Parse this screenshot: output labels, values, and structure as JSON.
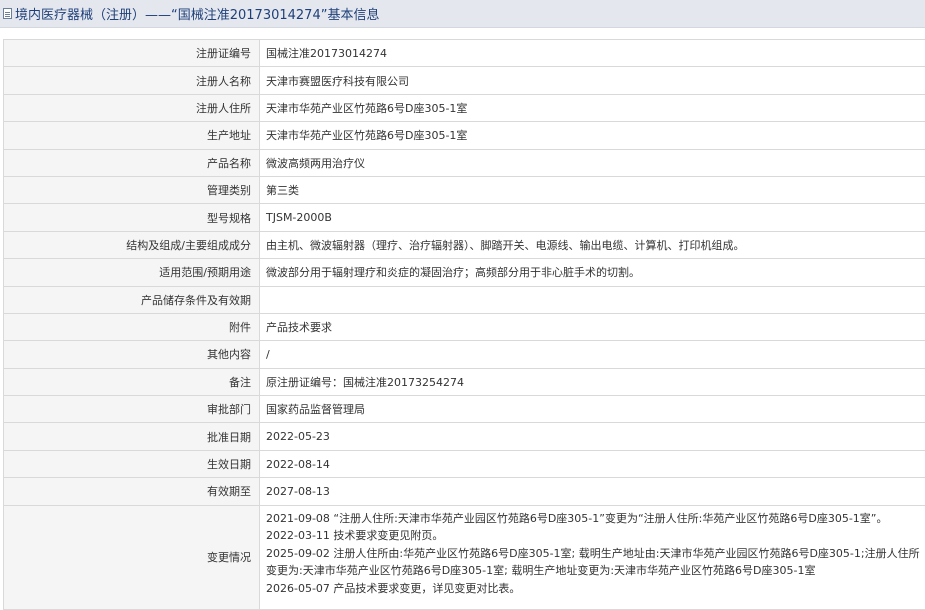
{
  "header": {
    "title": "境内医疗器械（注册）——“国械注准20173014274”基本信息"
  },
  "rows": [
    {
      "label": "注册证编号",
      "value": "国械注准20173014274"
    },
    {
      "label": "注册人名称",
      "value": "天津市赛盟医疗科技有限公司"
    },
    {
      "label": "注册人住所",
      "value": "天津市华苑产业区竹苑路6号D座305-1室"
    },
    {
      "label": "生产地址",
      "value": "天津市华苑产业区竹苑路6号D座305-1室"
    },
    {
      "label": "产品名称",
      "value": "微波高频两用治疗仪"
    },
    {
      "label": "管理类别",
      "value": "第三类"
    },
    {
      "label": "型号规格",
      "value": "TJSM-2000B"
    },
    {
      "label": "结构及组成/主要组成成分",
      "value": "由主机、微波辐射器（理疗、治疗辐射器）、脚踏开关、电源线、输出电缆、计算机、打印机组成。"
    },
    {
      "label": "适用范围/预期用途",
      "value": "微波部分用于辐射理疗和炎症的凝固治疗；高频部分用于非心脏手术的切割。"
    },
    {
      "label": "产品储存条件及有效期",
      "value": ""
    },
    {
      "label": "附件",
      "value": "产品技术要求"
    },
    {
      "label": "其他内容",
      "value": "/"
    },
    {
      "label": "备注",
      "value": "原注册证编号：国械注准20173254274"
    },
    {
      "label": "审批部门",
      "value": "国家药品监督管理局"
    },
    {
      "label": "批准日期",
      "value": "2022-05-23"
    },
    {
      "label": "生效日期",
      "value": "2022-08-14"
    },
    {
      "label": "有效期至",
      "value": "2027-08-13"
    }
  ],
  "changes": {
    "label": "变更情况",
    "lines": [
      "2021-09-08 “注册人住所:天津市华苑产业园区竹苑路6号D座305-1”变更为“注册人住所:华苑产业区竹苑路6号D座305-1室”。",
      "2022-03-11 技术要求变更见附页。",
      "2025-09-02 注册人住所由:华苑产业区竹苑路6号D座305-1室; 载明生产地址由:天津市华苑产业园区竹苑路6号D座305-1;注册人住所",
      "变更为:天津市华苑产业区竹苑路6号D座305-1室; 载明生产地址变更为:天津市华苑产业区竹苑路6号D座305-1室",
      "2026-05-07 产品技术要求变更，详见变更对比表。"
    ]
  }
}
